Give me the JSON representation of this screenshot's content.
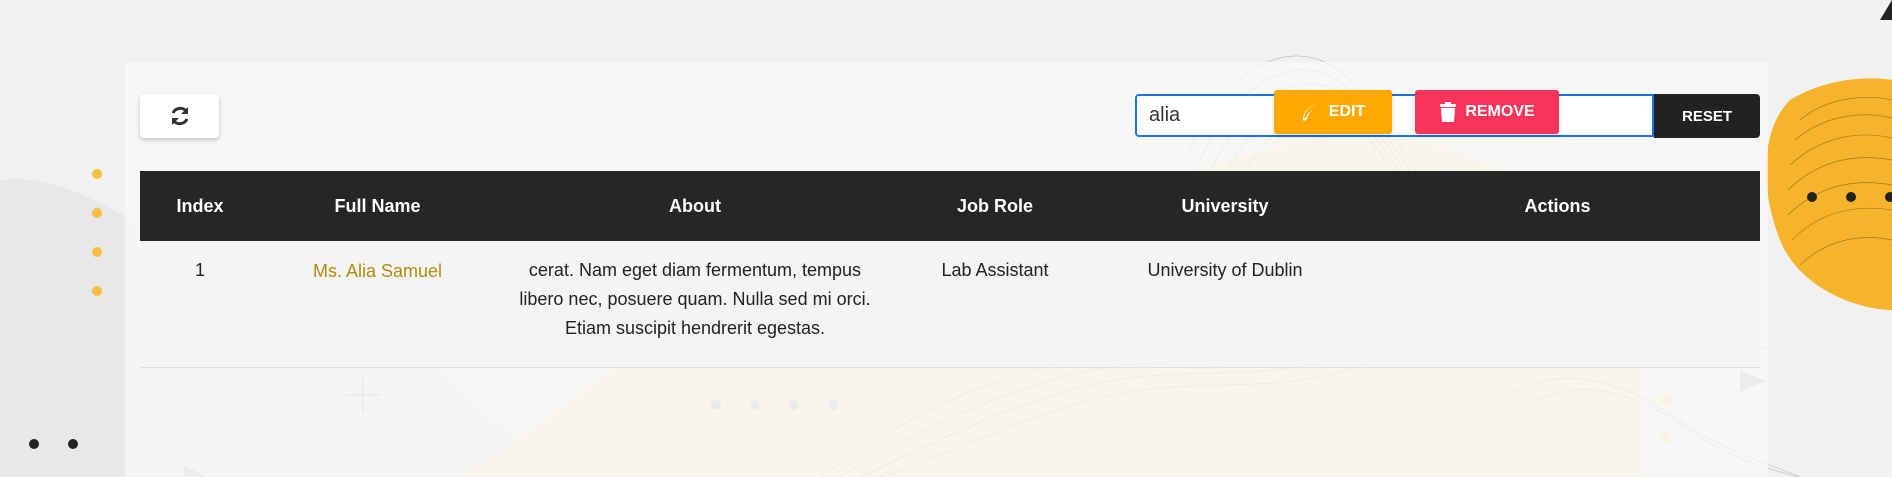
{
  "toolbar": {
    "refresh_icon": "refresh-icon",
    "search_value": "alia",
    "reset_label": "RESET"
  },
  "table": {
    "headers": {
      "index": "Index",
      "full_name": "Full Name",
      "about": "About",
      "job_role": "Job Role",
      "university": "University",
      "actions": "Actions"
    },
    "rows": [
      {
        "index": "1",
        "full_name": "Ms. Alia Samuel",
        "about_line1": "cerat. Nam eget diam fermentum, tempus",
        "about_line2": "libero nec, posuere quam. Nulla sed mi orci.",
        "about_line3": "Etiam suscipit hendrerit egestas.",
        "job_role": "Lab Assistant",
        "university": "University of Dublin",
        "edit_label": "EDIT",
        "remove_label": "REMOVE"
      }
    ]
  },
  "colors": {
    "header_bg": "#262626",
    "accent_yellow": "#ffa800",
    "accent_red": "#f7345a",
    "name_color": "#b58b0e",
    "search_border": "#1a73e8"
  }
}
